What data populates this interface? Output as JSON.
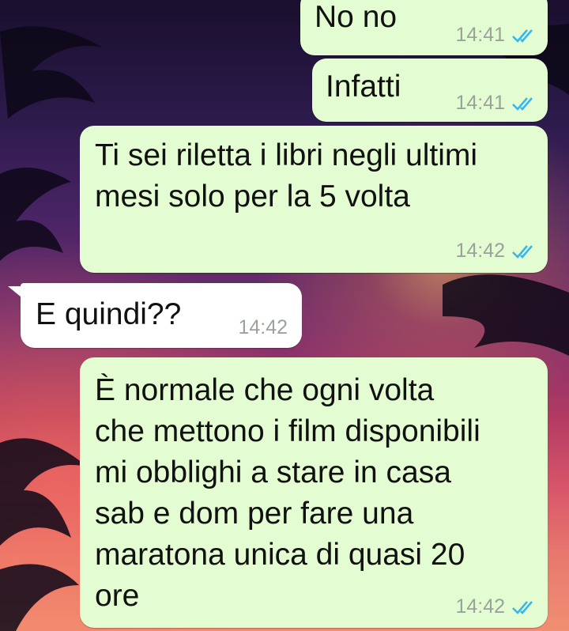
{
  "messages": [
    {
      "text": "No no",
      "time": "14:41",
      "direction": "outgoing",
      "status_icon": "double-check-read-icon"
    },
    {
      "text": "Infatti",
      "time": "14:41",
      "direction": "outgoing",
      "status_icon": "double-check-read-icon"
    },
    {
      "text": "Ti sei riletta i libri negli ultimi\nmesi solo per la 5 volta",
      "time": "14:42",
      "direction": "outgoing",
      "status_icon": "double-check-read-icon"
    },
    {
      "text": "E quindi??",
      "time": "14:42",
      "direction": "incoming"
    },
    {
      "text": "È normale che ogni volta\nche mettono i film disponibili\nmi obblighi a stare in casa\nsab e dom per fare una\nmaratona unica di quasi 20\nore",
      "time": "14:42",
      "direction": "outgoing",
      "status_icon": "double-check-read-icon"
    }
  ],
  "colors": {
    "outgoing_bubble": "#e3fcd2",
    "incoming_bubble": "#ffffff",
    "read_ticks": "#34b7f1",
    "timestamp": "#9aa39a"
  }
}
